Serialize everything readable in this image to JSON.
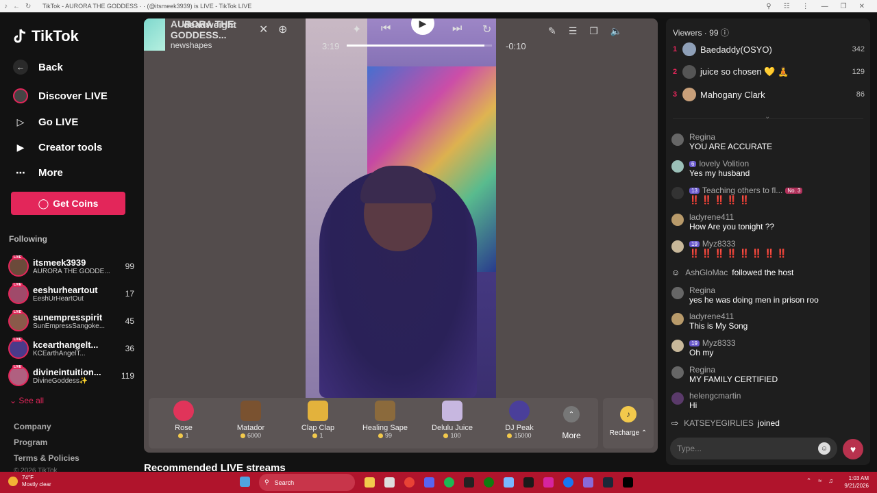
{
  "browser": {
    "title": "TikTok - AURORA THE GODDESS · · (@itsmeek3939) is LIVE - TikTok LIVE"
  },
  "sidebar": {
    "logo": "TikTok",
    "back": "Back",
    "nav": [
      "Discover LIVE",
      "Go LIVE",
      "Creator tools",
      "More"
    ],
    "get_coins": "Get Coins",
    "following_label": "Following",
    "following": [
      {
        "name": "itsmeek3939",
        "sub": "AURORA THE GODDE...",
        "count": "99"
      },
      {
        "name": "eeshurheartout",
        "sub": "EeshUrHeartOut",
        "count": "17"
      },
      {
        "name": "sunempresspirit",
        "sub": "SunEmpressSangoke...",
        "count": "45"
      },
      {
        "name": "kcearthangelt...",
        "sub": "KCEarthAngelT...",
        "count": "36"
      },
      {
        "name": "divineintuition...",
        "sub": "DivineGoddess✨",
        "count": "119"
      }
    ],
    "live_tag": "LIVE",
    "see_all": "See all",
    "footer": [
      "Company",
      "Program",
      "Terms & Policies"
    ],
    "copyright": "© 2026 TikTok"
  },
  "player": {
    "mini_title": "AURORA THE GODDESS...",
    "mini_overlay": "deadweight",
    "mini_sub": "newshapes",
    "time_elapsed": "3:19",
    "time_remaining": "-0:10",
    "progress": 0.95
  },
  "gifts": [
    {
      "name": "Rose",
      "price": "1",
      "color": "#e0345a"
    },
    {
      "name": "Matador",
      "price": "6000",
      "color": "#7a5230"
    },
    {
      "name": "Clap Clap",
      "price": "1",
      "color": "#e3b23c"
    },
    {
      "name": "Healing Sape",
      "price": "99",
      "color": "#8b6a3c"
    },
    {
      "name": "Delulu Juice",
      "price": "100",
      "color": "#c7b7e0"
    },
    {
      "name": "DJ Peak",
      "price": "15000",
      "color": "#4a3f9a"
    }
  ],
  "gift_more": "More",
  "recharge": "Recharge",
  "recommended": "Recommended LIVE streams",
  "panel": {
    "viewers_label": "Viewers",
    "viewers_count": "99",
    "top_viewers": [
      {
        "rank": "1",
        "name": "Baedaddy(OSYO)",
        "score": "342"
      },
      {
        "rank": "2",
        "name": "juice so chosen 💛 🧘",
        "score": "129"
      },
      {
        "rank": "3",
        "name": "Mahogany Clark",
        "score": "86"
      }
    ],
    "chat": [
      {
        "user": "Regina",
        "msg": "YOU ARE ACCURATE",
        "badge": ""
      },
      {
        "user": "lovely Volition",
        "msg": "Yes my husband",
        "badge": "6"
      },
      {
        "user": "Teaching others to fl...",
        "msg": "‼️ ‼️ ‼️ ‼️ ‼️",
        "badge": "13",
        "extra": "No. 3"
      },
      {
        "user": "ladyrene411",
        "msg": "How Are you tonight ??",
        "badge": ""
      },
      {
        "user": "Myz8333",
        "msg": "‼️ ‼️ ‼️ ‼️ ‼️ ‼️ ‼️ ‼️",
        "badge": "19"
      }
    ],
    "follow_event": {
      "user": "AshGloMac",
      "text": "followed the host"
    },
    "chat2": [
      {
        "user": "Regina",
        "msg": "yes he was doing men in prison roo",
        "badge": ""
      },
      {
        "user": "ladyrene411",
        "msg": "This is My Song",
        "badge": ""
      },
      {
        "user": "Myz8333",
        "msg": "Oh my",
        "badge": "19"
      },
      {
        "user": "Regina",
        "msg": "MY FAMILY CERTIFIED",
        "badge": ""
      },
      {
        "user": "helengcmartin",
        "msg": "Hi",
        "badge": ""
      }
    ],
    "join_event": {
      "user": "KATSEYEGIRLIES",
      "text": "joined"
    },
    "input_placeholder": "Type..."
  },
  "taskbar": {
    "temp": "74°F",
    "weather": "Mostly clear",
    "search": "Search",
    "time": "1:03 AM",
    "date": "9/21/2026"
  }
}
